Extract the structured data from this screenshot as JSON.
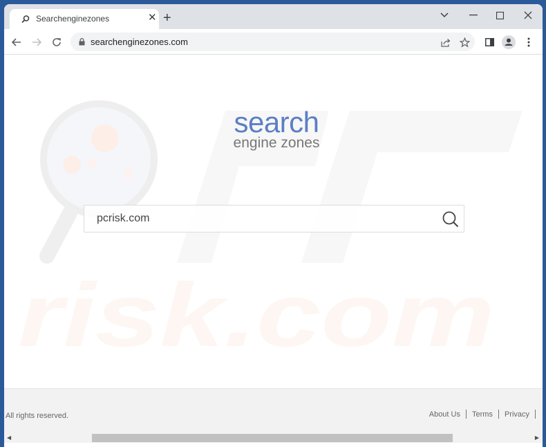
{
  "browser": {
    "tab_title": "Searchenginezones",
    "tab_favicon": "search-icon",
    "url": "searchenginezones.com",
    "window_controls": [
      "tab-search",
      "minimize",
      "maximize",
      "close"
    ],
    "toolbar_icons": [
      "share-icon",
      "bookmark-star-icon",
      "side-panel-icon",
      "profile-icon",
      "menu-icon"
    ]
  },
  "page": {
    "logo": {
      "primary": "search",
      "secondary": "engine zones",
      "primary_color": "#5b7fc4",
      "secondary_color": "#777777"
    },
    "search": {
      "value": "pcrisk.com",
      "placeholder": ""
    },
    "watermark": {
      "text": "risk.com",
      "prefix": "PC"
    }
  },
  "footer": {
    "copyright": "All rights reserved.",
    "links": [
      "About Us",
      "Terms",
      "Privacy"
    ]
  }
}
